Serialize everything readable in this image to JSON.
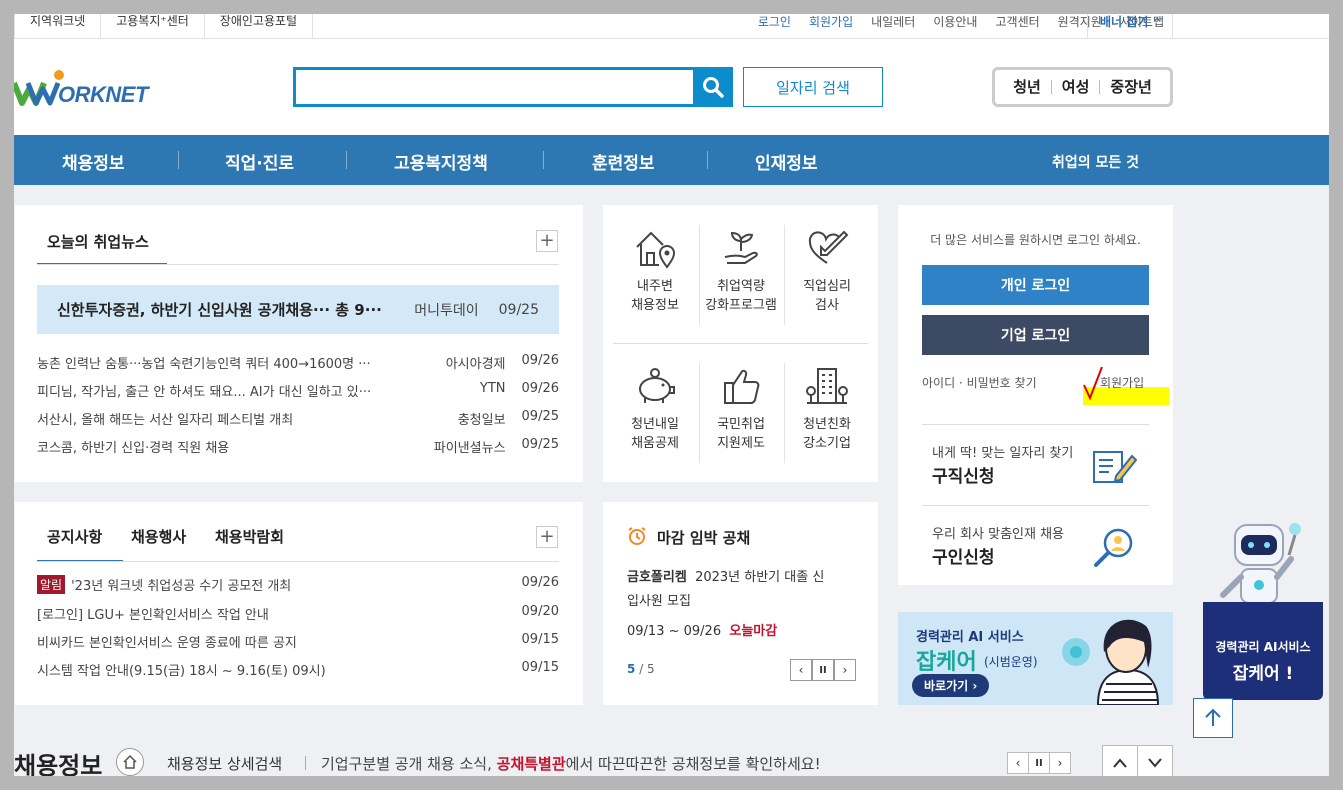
{
  "util_left": [
    "지역워크넷",
    "고용복지⁺센터",
    "장애인고용포털"
  ],
  "util_right": {
    "login": "로그인",
    "signup": "회원가입",
    "mail": "내일레터",
    "guide": "이용안내",
    "cs": "고객센터",
    "remote": "원격지원",
    "sitemap": "사이트맵",
    "banner_fold": "배너 접기"
  },
  "logo": "WORKNET",
  "search": {
    "placeholder": "",
    "job_search_label": "일자리 검색"
  },
  "segments": [
    "청년",
    "여성",
    "중장년"
  ],
  "nav": {
    "items": [
      "채용정보",
      "직업·진로",
      "고용복지정책",
      "훈련정보",
      "인재정보"
    ],
    "all": "취업의 모든 것"
  },
  "news": {
    "title": "오늘의 취업뉴스",
    "featured": {
      "title": "신한투자증권, 하반기 신입사원 공개채용··· 총 9···",
      "source": "머니투데이",
      "date": "09/25"
    },
    "rows": [
      {
        "title": "농촌 인력난 숨통···농업 숙련기능인력 쿼터 400→1600명 ···",
        "source": "아시아경제",
        "date": "09/26"
      },
      {
        "title": "피디님, 작가님, 출근 안 하셔도 돼요... AI가 대신 일하고 있···",
        "source": "YTN",
        "date": "09/26"
      },
      {
        "title": "서산시, 올해 해뜨는 서산 일자리 페스티벌 개최",
        "source": "충청일보",
        "date": "09/25"
      },
      {
        "title": "코스콤, 하반기 신입·경력 직원 채용",
        "source": "파이낸셜뉴스",
        "date": "09/25"
      }
    ]
  },
  "tiles": [
    {
      "l1": "내주변",
      "l2": "채용정보"
    },
    {
      "l1": "취업역량",
      "l2": "강화프로그램"
    },
    {
      "l1": "직업심리",
      "l2": "검사"
    },
    {
      "l1": "청년내일",
      "l2": "채움공제"
    },
    {
      "l1": "국민취업",
      "l2": "지원제도"
    },
    {
      "l1": "청년친화",
      "l2": "강소기업"
    }
  ],
  "notices": {
    "tabs": [
      "공지사항",
      "채용행사",
      "채용박람회"
    ],
    "rows": [
      {
        "badge": "알림",
        "title": "'23년 워크넷 취업성공 수기 공모전 개최",
        "date": "09/26"
      },
      {
        "title": "[로그인] LGU+ 본인확인서비스 작업 안내",
        "date": "09/20"
      },
      {
        "title": "비씨카드 본인확인서비스 운영 종료에 따른 공지",
        "date": "09/15"
      },
      {
        "title": "시스템 작업 안내(9.15(금) 18시 ~ 9.16(토) 09시)",
        "date": "09/15"
      }
    ]
  },
  "deadline": {
    "title": "마감 임박 공채",
    "company": "금호폴리켐",
    "desc1": "2023년 하반기 대졸 신",
    "desc2": "입사원 모집",
    "period": "09/13 ~ 09/26",
    "badge": "오늘마감",
    "page_current": "5",
    "page_total": "/ 5"
  },
  "login": {
    "hint": "더 많은 서비스를 원하시면 로그인 하세요.",
    "personal": "개인 로그인",
    "company": "기업 로그인",
    "find": "아이디 · 비밀번호 찾기",
    "signup": "회원가입"
  },
  "seek": {
    "sub": "내게 딱! 맞는 일자리 찾기",
    "title": "구직신청"
  },
  "hire": {
    "sub": "우리 회사 맞춤인재 채용",
    "title": "구인신청"
  },
  "ai_banner": {
    "l1": "경력관리 AI 서비스",
    "l2": "잡케어",
    "l3": "(시범운영)",
    "go": "바로가기"
  },
  "robot": {
    "l1": "경력관리 AI서비스",
    "l2": "잡케어 !"
  },
  "bottom": {
    "title": "채용정보",
    "detail": "채용정보 상세검색",
    "desc_pre": "기업구분별 공개 채용 소식, ",
    "desc_em": "공채특별관",
    "desc_post": "에서 따끈따끈한 공채정보를 확인하세요!"
  },
  "colors": {
    "nav": "#2d78b3",
    "search": "#0d8ccc",
    "login_personal": "#2f82c5",
    "login_company": "#3c4a63",
    "highlight": "#ffff00",
    "red_check": "#e00000"
  }
}
